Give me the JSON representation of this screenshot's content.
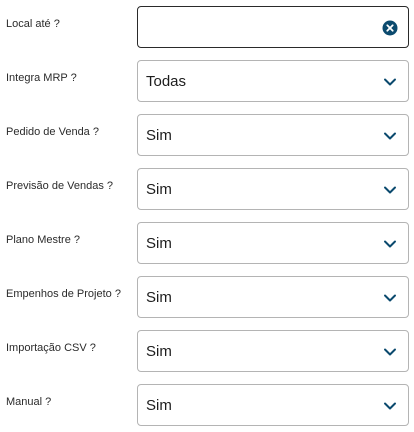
{
  "form": {
    "local_ate": {
      "label": "Local até ?",
      "value": "",
      "placeholder": ""
    },
    "integra_mrp": {
      "label": "Integra MRP ?",
      "value": "Todas"
    },
    "pedido_venda": {
      "label": "Pedido de Venda ?",
      "value": "Sim"
    },
    "previsao_vendas": {
      "label": "Previsão de Vendas ?",
      "value": "Sim"
    },
    "plano_mestre": {
      "label": "Plano Mestre ?",
      "value": "Sim"
    },
    "empenhos_projeto": {
      "label": "Empenhos de Projeto ?",
      "value": "Sim"
    },
    "importacao_csv": {
      "label": "Importação CSV ?",
      "value": "Sim"
    },
    "manual": {
      "label": "Manual ?",
      "value": "Sim"
    }
  },
  "icons": {
    "clear": "clear-circle-x-icon",
    "dropdown": "chevron-down-icon"
  },
  "colors": {
    "icon": "#0b4a6e",
    "border": "#b4b4b4",
    "focused_border": "#2a2a2a"
  }
}
